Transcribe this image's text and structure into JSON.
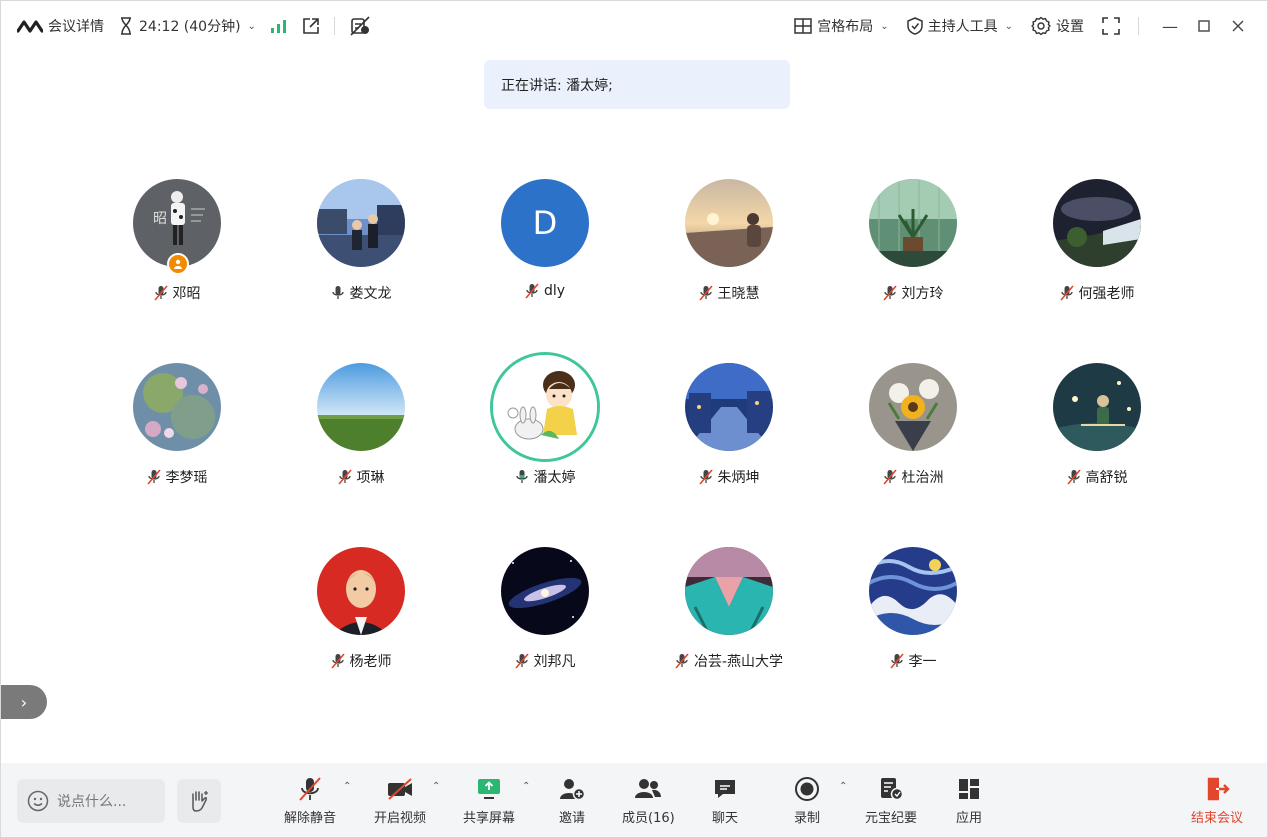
{
  "topbar": {
    "meeting_details": "会议详情",
    "timer": "24:12 (40分钟)",
    "layout": "宫格布局",
    "host_tools": "主持人工具",
    "settings": "设置"
  },
  "speaking": {
    "text": "正在讲话: 潘太婷;"
  },
  "participants": [
    {
      "name": "邓昭",
      "mic": "muted",
      "host": true
    },
    {
      "name": "娄文龙",
      "mic": "on"
    },
    {
      "name": "dly",
      "mic": "muted",
      "letter": "D"
    },
    {
      "name": "王晓慧",
      "mic": "muted"
    },
    {
      "name": "刘方玲",
      "mic": "muted"
    },
    {
      "name": "何强老师",
      "mic": "muted"
    },
    {
      "name": "李梦瑶",
      "mic": "muted"
    },
    {
      "name": "项琳",
      "mic": "muted"
    },
    {
      "name": "潘太婷",
      "mic": "on",
      "speaking": true
    },
    {
      "name": "朱炳坤",
      "mic": "muted"
    },
    {
      "name": "杜治洲",
      "mic": "muted"
    },
    {
      "name": "高舒锐",
      "mic": "muted"
    },
    {
      "name": "杨老师",
      "mic": "muted"
    },
    {
      "name": "刘邦凡",
      "mic": "muted"
    },
    {
      "name": "冶芸-燕山大学",
      "mic": "muted"
    },
    {
      "name": "李一",
      "mic": "muted"
    }
  ],
  "bottombar": {
    "chat_placeholder": "说点什么...",
    "unmute": "解除静音",
    "start_video": "开启视频",
    "share_screen": "共享屏幕",
    "invite": "邀请",
    "members": "成员(16)",
    "chat": "聊天",
    "record": "录制",
    "yuanbao": "元宝纪要",
    "apps": "应用",
    "end_meeting": "结束会议"
  },
  "colors": {
    "accent_blue": "#2d72c9",
    "speaking_ring": "#3fc79a",
    "host_badge": "#f28b00",
    "end_meeting": "#e2462d",
    "banner_bg": "#eaf1fd"
  }
}
